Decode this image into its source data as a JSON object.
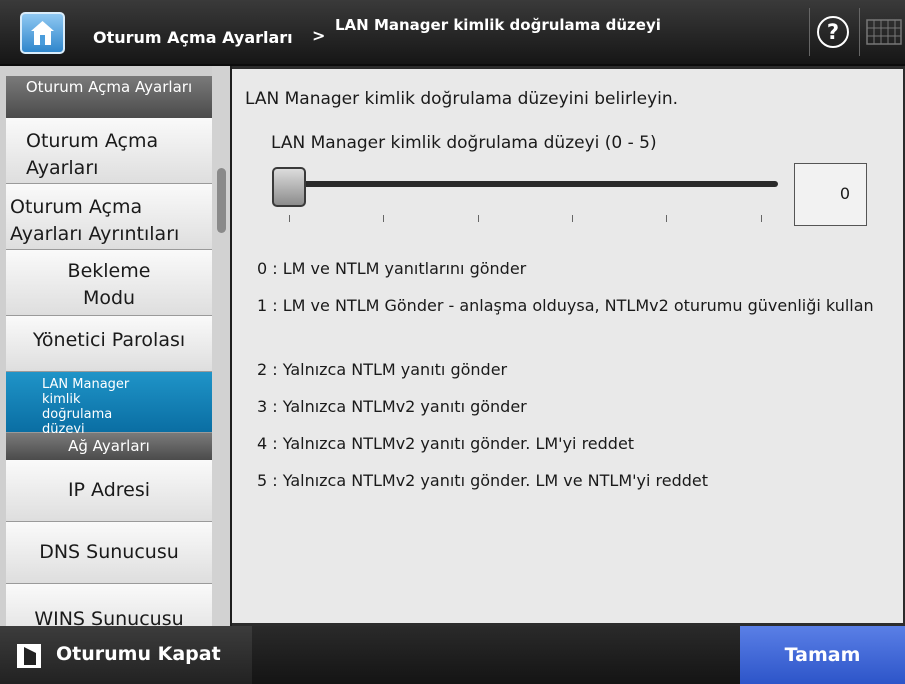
{
  "header": {
    "breadcrumb_parent": "Oturum Açma Ayarları",
    "breadcrumb_separator": ">",
    "page_title": "LAN Manager kimlik doğrulama düzeyi",
    "help_symbol": "?",
    "icons": [
      "home-icon",
      "help-icon",
      "keyboard-icon"
    ]
  },
  "sidebar": {
    "group_logon": "Oturum Açma Ayarları",
    "items_logon": [
      "Oturum Açma Ayarları",
      "Oturum Açma Ayarları Ayrıntıları",
      "Bekleme Modu",
      "Yönetici Parolası",
      "LAN Manager kimlik doğrulama düzeyi"
    ],
    "group_network": "Ağ Ayarları",
    "items_network": [
      "IP Adresi",
      "DNS Sunucusu",
      "WINS Sunucusu"
    ],
    "selected_item": "LAN Manager kimlik doğrulama düzeyi"
  },
  "main": {
    "instruction": "LAN Manager kimlik doğrulama düzeyini belirleyin.",
    "slider_label": "LAN Manager kimlik doğrulama düzeyi (0 - 5)",
    "slider": {
      "min": 0,
      "max": 5,
      "value": 0
    },
    "value_display": "0",
    "options": [
      "0 : LM ve NTLM yanıtlarını gönder",
      "1 : LM ve NTLM Gönder - anlaşma olduysa, NTLMv2 oturumu güvenliği kullan",
      "2 : Yalnızca NTLM yanıtı gönder",
      "3 : Yalnızca NTLMv2 yanıtı gönder",
      "4 : Yalnızca NTLMv2 yanıtı gönder. LM'yi reddet",
      "5 : Yalnızca NTLMv2 yanıtı gönder. LM ve NTLM'yi reddet"
    ]
  },
  "footer": {
    "logout_label": "Oturumu Kapat",
    "ok_label": "Tamam",
    "ok_color": "#3a62d6"
  }
}
